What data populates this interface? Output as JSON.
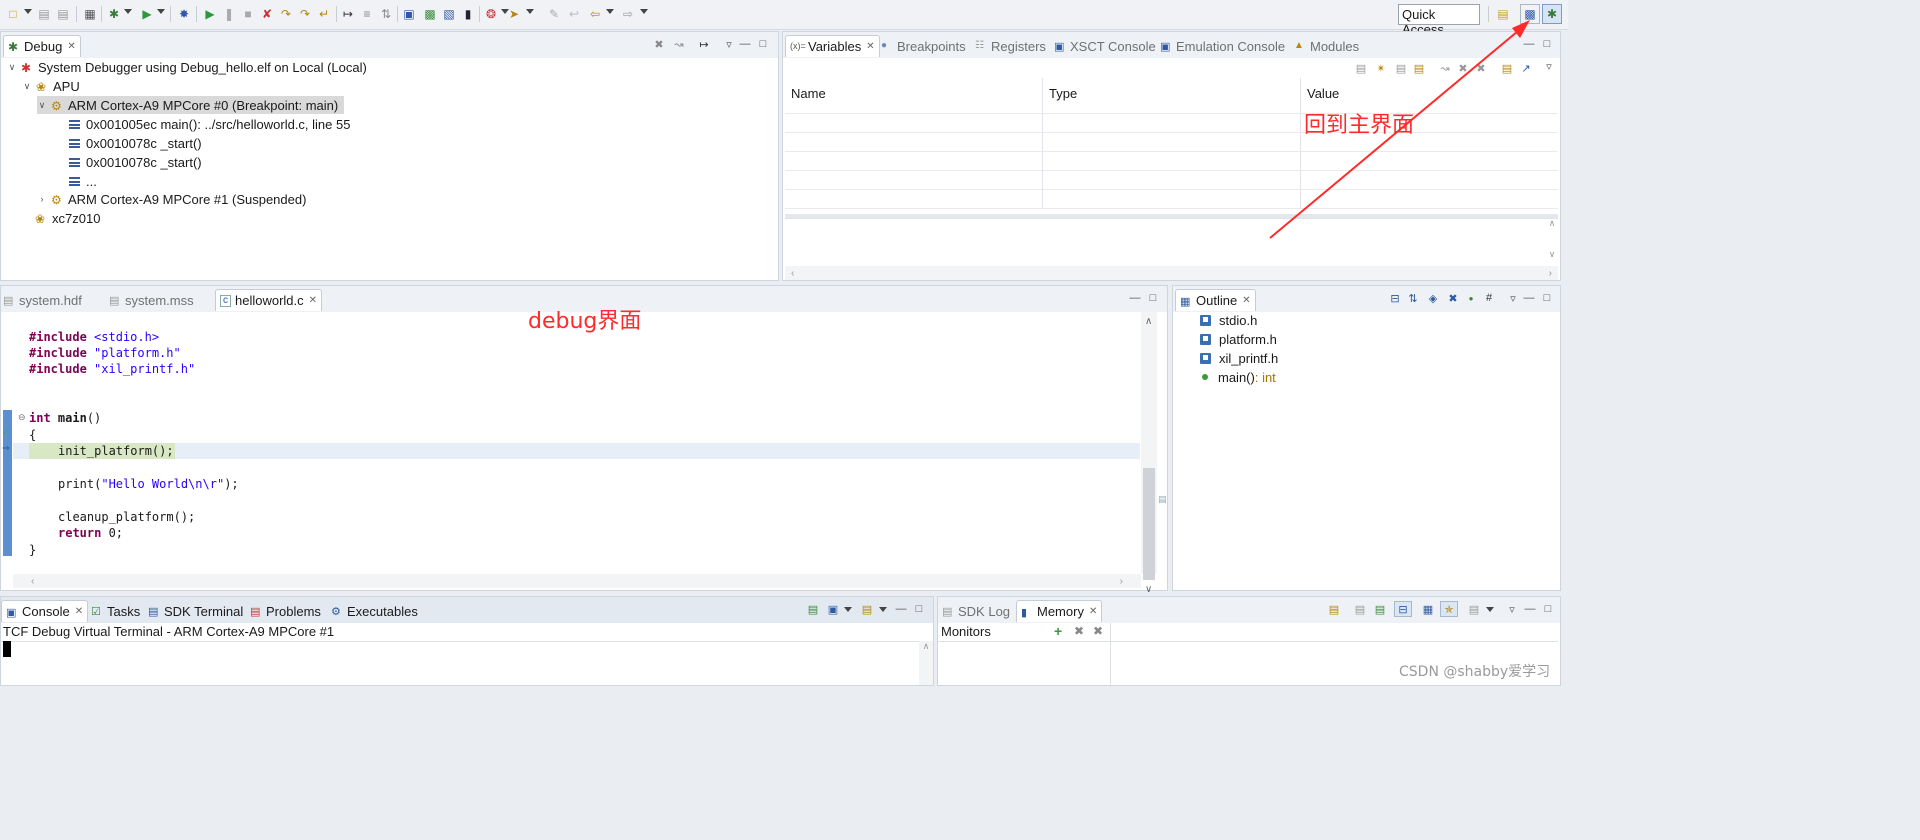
{
  "toolbar": {
    "quick_access": "Quick Access"
  },
  "debug_view": {
    "tab": "Debug",
    "tree": [
      {
        "label": "System Debugger using Debug_hello.elf on Local (Local)"
      },
      {
        "label": "APU"
      },
      {
        "label": "ARM Cortex-A9 MPCore #0 (Breakpoint: main)"
      },
      {
        "label": "0x001005ec main(): ../src/helloworld.c, line 55"
      },
      {
        "label": "0x0010078c _start()"
      },
      {
        "label": "0x0010078c _start()"
      },
      {
        "label": "..."
      },
      {
        "label": "ARM Cortex-A9 MPCore #1 (Suspended)"
      },
      {
        "label": "xc7z010"
      }
    ]
  },
  "variables_view": {
    "tabs": [
      "Variables",
      "Breakpoints",
      "Registers",
      "XSCT Console",
      "Emulation Console",
      "Modules"
    ],
    "columns": [
      "Name",
      "Type",
      "Value"
    ]
  },
  "annotations": {
    "main_window": "回到主界面",
    "debug": "debug界面"
  },
  "editor": {
    "tabs": [
      "system.hdf",
      "system.mss",
      "helloworld.c"
    ],
    "lines": [
      [
        "#include",
        " ",
        "<stdio.h>"
      ],
      [
        "#include",
        " ",
        "\"platform.h\""
      ],
      [
        "#include",
        " ",
        "\"xil_printf.h\""
      ],
      [
        "int",
        " ",
        "main",
        "()"
      ],
      [
        "{"
      ],
      [
        "init_platform();"
      ],
      [
        "print(",
        "\"Hello World\\n\\r\"",
        ");"
      ],
      [
        "cleanup_platform();"
      ],
      [
        "return",
        " 0;"
      ],
      [
        "}"
      ]
    ]
  },
  "outline": {
    "tab": "Outline",
    "items": [
      {
        "label": "stdio.h"
      },
      {
        "label": "platform.h"
      },
      {
        "label": "xil_printf.h"
      },
      {
        "label": "main()",
        "type": " : int"
      }
    ]
  },
  "console": {
    "tabs": [
      "Console",
      "Tasks",
      "SDK Terminal",
      "Problems",
      "Executables"
    ],
    "title": "TCF Debug Virtual Terminal - ARM Cortex-A9 MPCore #1"
  },
  "memory": {
    "tabs": [
      "SDK Log",
      "Memory"
    ],
    "monitors_label": "Monitors"
  },
  "watermark": "CSDN @shabby爱学习",
  "colors": {
    "annotation": "#ff2a2a",
    "keyword": "#7f0055",
    "string": "#2a00ff",
    "highlight": "#d9e8c4"
  }
}
